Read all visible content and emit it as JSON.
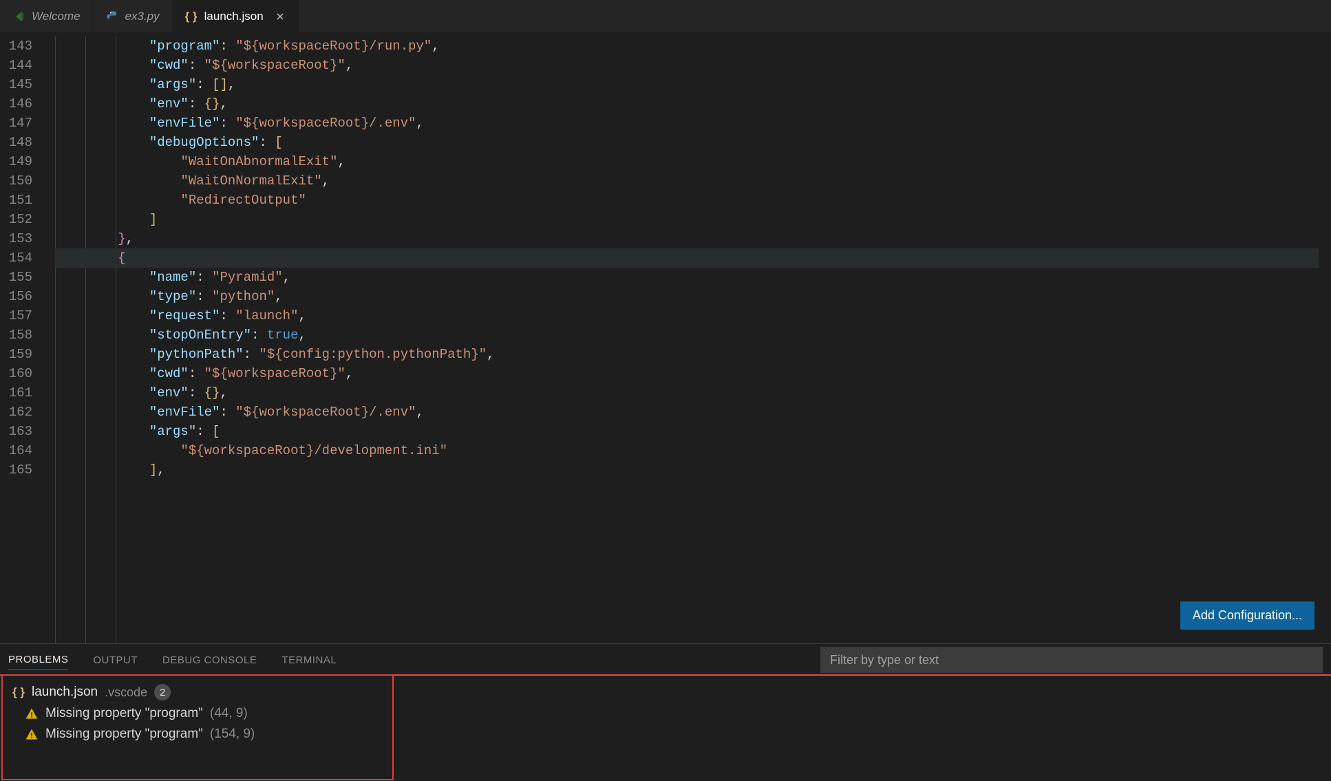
{
  "tabs": [
    {
      "label": "Welcome",
      "icon": "vscode"
    },
    {
      "label": "ex3.py",
      "icon": "python"
    },
    {
      "label": "launch.json",
      "icon": "braces",
      "active": true,
      "closeable": true
    }
  ],
  "editor": {
    "first_line_number": 143,
    "highlight_line": 154,
    "add_configuration_label": "Add Configuration...",
    "lines": [
      [
        [
          "pad",
          "            "
        ],
        [
          "key",
          "\"program\""
        ],
        [
          "punc",
          ": "
        ],
        [
          "str",
          "\"${workspaceRoot}/run.py\""
        ],
        [
          "punc",
          ","
        ]
      ],
      [
        [
          "pad",
          "            "
        ],
        [
          "key",
          "\"cwd\""
        ],
        [
          "punc",
          ": "
        ],
        [
          "str",
          "\"${workspaceRoot}\""
        ],
        [
          "punc",
          ","
        ]
      ],
      [
        [
          "pad",
          "            "
        ],
        [
          "key",
          "\"args\""
        ],
        [
          "punc",
          ": "
        ],
        [
          "br1",
          "["
        ],
        [
          "br1",
          "]"
        ],
        [
          "punc",
          ","
        ]
      ],
      [
        [
          "pad",
          "            "
        ],
        [
          "key",
          "\"env\""
        ],
        [
          "punc",
          ": "
        ],
        [
          "br1",
          "{"
        ],
        [
          "br1",
          "}"
        ],
        [
          "punc",
          ","
        ]
      ],
      [
        [
          "pad",
          "            "
        ],
        [
          "key",
          "\"envFile\""
        ],
        [
          "punc",
          ": "
        ],
        [
          "str",
          "\"${workspaceRoot}/.env\""
        ],
        [
          "punc",
          ","
        ]
      ],
      [
        [
          "pad",
          "            "
        ],
        [
          "key",
          "\"debugOptions\""
        ],
        [
          "punc",
          ": "
        ],
        [
          "br1",
          "["
        ]
      ],
      [
        [
          "pad",
          "                "
        ],
        [
          "str",
          "\"WaitOnAbnormalExit\""
        ],
        [
          "punc",
          ","
        ]
      ],
      [
        [
          "pad",
          "                "
        ],
        [
          "str",
          "\"WaitOnNormalExit\""
        ],
        [
          "punc",
          ","
        ]
      ],
      [
        [
          "pad",
          "                "
        ],
        [
          "str",
          "\"RedirectOutput\""
        ]
      ],
      [
        [
          "pad",
          "            "
        ],
        [
          "br1",
          "]"
        ]
      ],
      [
        [
          "pad",
          "        "
        ],
        [
          "br2",
          "}"
        ],
        [
          "punc",
          ","
        ]
      ],
      [
        [
          "pad",
          "        "
        ],
        [
          "br2",
          "{"
        ]
      ],
      [
        [
          "pad",
          "            "
        ],
        [
          "key",
          "\"name\""
        ],
        [
          "punc",
          ": "
        ],
        [
          "str",
          "\"Pyramid\""
        ],
        [
          "punc",
          ","
        ]
      ],
      [
        [
          "pad",
          "            "
        ],
        [
          "key",
          "\"type\""
        ],
        [
          "punc",
          ": "
        ],
        [
          "str",
          "\"python\""
        ],
        [
          "punc",
          ","
        ]
      ],
      [
        [
          "pad",
          "            "
        ],
        [
          "key",
          "\"request\""
        ],
        [
          "punc",
          ": "
        ],
        [
          "str",
          "\"launch\""
        ],
        [
          "punc",
          ","
        ]
      ],
      [
        [
          "pad",
          "            "
        ],
        [
          "key",
          "\"stopOnEntry\""
        ],
        [
          "punc",
          ": "
        ],
        [
          "bool",
          "true"
        ],
        [
          "punc",
          ","
        ]
      ],
      [
        [
          "pad",
          "            "
        ],
        [
          "key",
          "\"pythonPath\""
        ],
        [
          "punc",
          ": "
        ],
        [
          "str",
          "\"${config:python.pythonPath}\""
        ],
        [
          "punc",
          ","
        ]
      ],
      [
        [
          "pad",
          "            "
        ],
        [
          "key",
          "\"cwd\""
        ],
        [
          "punc",
          ": "
        ],
        [
          "str",
          "\"${workspaceRoot}\""
        ],
        [
          "punc",
          ","
        ]
      ],
      [
        [
          "pad",
          "            "
        ],
        [
          "key",
          "\"env\""
        ],
        [
          "punc",
          ": "
        ],
        [
          "br1",
          "{"
        ],
        [
          "br1",
          "}"
        ],
        [
          "punc",
          ","
        ]
      ],
      [
        [
          "pad",
          "            "
        ],
        [
          "key",
          "\"envFile\""
        ],
        [
          "punc",
          ": "
        ],
        [
          "str",
          "\"${workspaceRoot}/.env\""
        ],
        [
          "punc",
          ","
        ]
      ],
      [
        [
          "pad",
          "            "
        ],
        [
          "key",
          "\"args\""
        ],
        [
          "punc",
          ": "
        ],
        [
          "br1",
          "["
        ]
      ],
      [
        [
          "pad",
          "                "
        ],
        [
          "str",
          "\"${workspaceRoot}/development.ini\""
        ]
      ],
      [
        [
          "pad",
          "            "
        ],
        [
          "br1",
          "]"
        ],
        [
          "punc",
          ","
        ]
      ]
    ]
  },
  "panel": {
    "tabs": [
      "PROBLEMS",
      "OUTPUT",
      "DEBUG CONSOLE",
      "TERMINAL"
    ],
    "active_tab": 0,
    "filter_placeholder": "Filter by type or text",
    "problems": {
      "file": "launch.json",
      "folder": ".vscode",
      "count": "2",
      "items": [
        {
          "message": "Missing property \"program\"",
          "location": "(44, 9)"
        },
        {
          "message": "Missing property \"program\"",
          "location": "(154, 9)"
        }
      ]
    }
  }
}
